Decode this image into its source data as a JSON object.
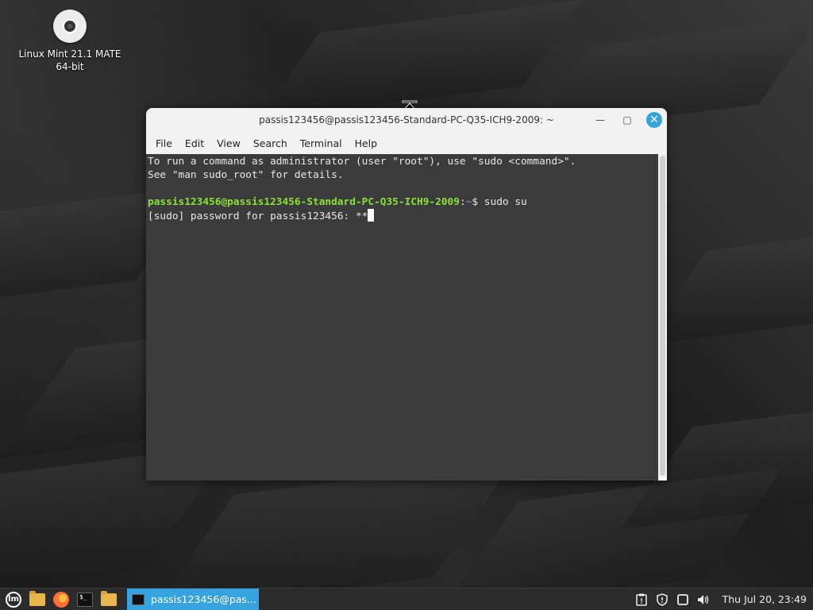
{
  "desktop": {
    "icons": [
      {
        "label_line1": "Linux Mint 21.1 MATE",
        "label_line2": "64-bit"
      }
    ]
  },
  "window": {
    "title": "passis123456@passis123456-Standard-PC-Q35-ICH9-2009: ~",
    "controls": {
      "minimize": "—",
      "maximize": "▢",
      "close": "✕"
    },
    "menu": [
      "File",
      "Edit",
      "View",
      "Search",
      "Terminal",
      "Help"
    ]
  },
  "terminal": {
    "line1": "To run a command as administrator (user \"root\"), use \"sudo <command>\".",
    "line2": "See \"man sudo_root\" for details.",
    "prompt_user": "passis123456@passis123456-Standard-PC-Q35-ICH9-2009",
    "prompt_sep": ":",
    "prompt_path": "~",
    "prompt_end": "$ ",
    "command": "sudo su",
    "line4": "[sudo] password for passis123456: **"
  },
  "taskbar": {
    "task_label": "passis123456@pas...",
    "clock": "Thu Jul 20, 23:49",
    "accent": "#35a3e0"
  }
}
